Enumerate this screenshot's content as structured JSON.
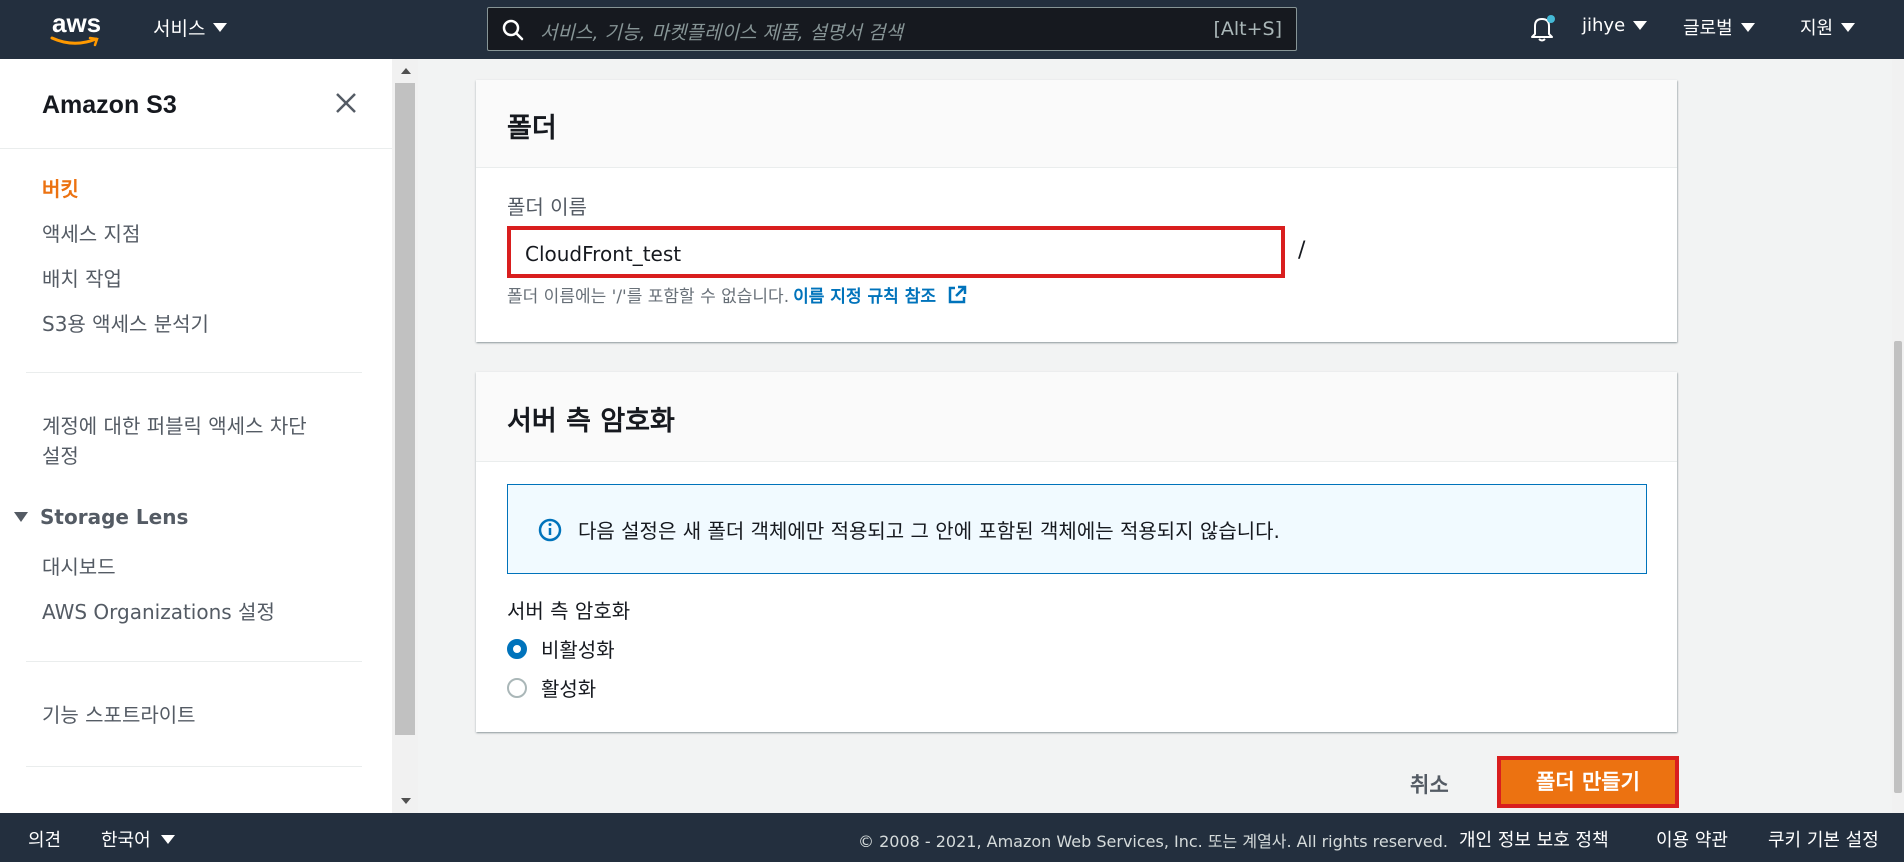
{
  "topnav": {
    "logo_text": "aws",
    "services_label": "서비스",
    "search_placeholder": "서비스, 기능, 마켓플레이스 제품, 설명서 검색",
    "search_shortcut": "[Alt+S]",
    "user": "jihye",
    "region": "글로벌",
    "support": "지원",
    "brand_color": "#232f3e",
    "notification_dot_color": "#44b9d6"
  },
  "sidebar": {
    "title": "Amazon S3",
    "items": [
      {
        "label": "버킷",
        "active": true
      },
      {
        "label": "액세스 지점"
      },
      {
        "label": "배치 작업"
      },
      {
        "label": "S3용 액세스 분석기"
      }
    ],
    "block_public_access_line1": "계정에 대한 퍼블릭 액세스 차단",
    "block_public_access_line2": "설정",
    "storage_lens": {
      "label": "Storage Lens",
      "items": [
        {
          "label": "대시보드"
        },
        {
          "label": "AWS Organizations 설정"
        }
      ]
    },
    "feature_spotlight": "기능 스포트라이트"
  },
  "folder_panel": {
    "title": "폴더",
    "field_label": "폴더 이름",
    "field_value": "CloudFront_test",
    "suffix": "/",
    "hint": "폴더 이름에는 '/'를 포함할 수 없습니다.",
    "hint_link": "이름 지정 규칙 참조"
  },
  "encryption_panel": {
    "title": "서버 측 암호화",
    "info_text": "다음 설정은 새 폴더 객체에만 적용되고 그 안에 포함된 객체에는 적용되지 않습니다.",
    "option_label": "서버 측 암호화",
    "options": [
      {
        "label": "비활성화",
        "selected": true
      },
      {
        "label": "활성화",
        "selected": false
      }
    ]
  },
  "actions": {
    "cancel": "취소",
    "create": "폴더 만들기",
    "primary_color": "#ec7211"
  },
  "footer": {
    "feedback": "의견",
    "language": "한국어",
    "copyright": "© 2008 - 2021, Amazon Web Services, Inc. 또는 계열사. All rights reserved.",
    "privacy": "개인 정보 보호 정책",
    "terms": "이용 약관",
    "cookies": "쿠키 기본 설정"
  }
}
